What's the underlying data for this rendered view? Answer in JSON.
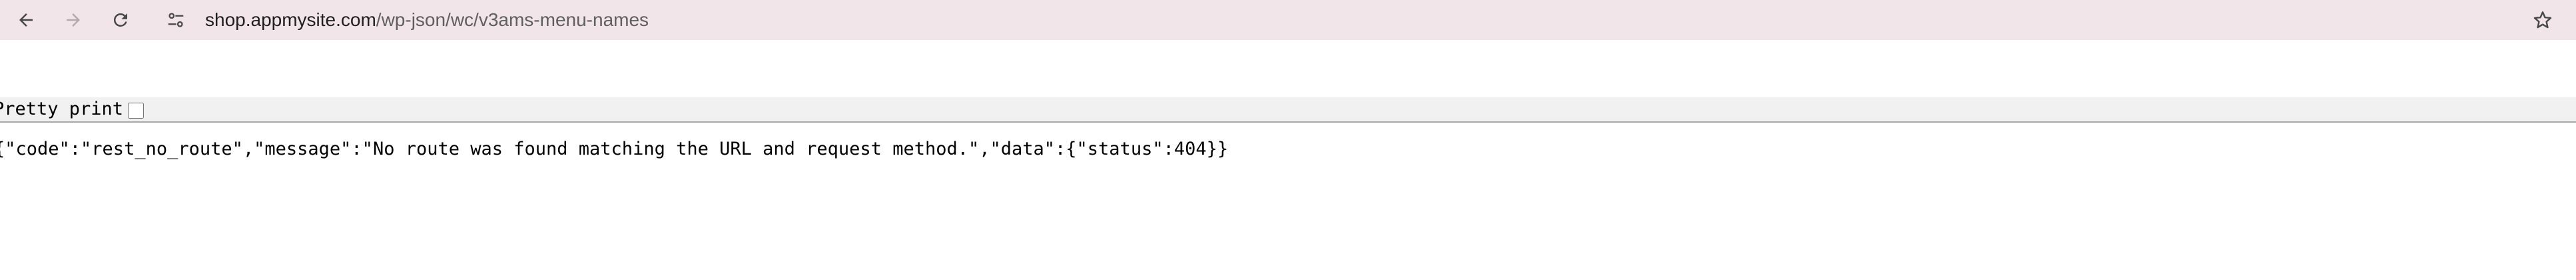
{
  "browser": {
    "url_host": "shop.appmysite.com",
    "url_path": "/wp-json/wc/v3ams-menu-names",
    "icons": {
      "back": "arrow-left-icon",
      "forward": "arrow-right-icon",
      "reload": "reload-icon",
      "site_info": "tune-icon",
      "bookmark": "star-icon"
    }
  },
  "pretty_print": {
    "label": "Pretty print",
    "checked": false
  },
  "response": {
    "text": "{\"code\":\"rest_no_route\",\"message\":\"No route was found matching the URL and request method.\",\"data\":{\"status\":404}}"
  },
  "colors": {
    "toolbar_bg": "#f1e5ea",
    "pretty_print_bar_bg": "#f1f1f1"
  }
}
